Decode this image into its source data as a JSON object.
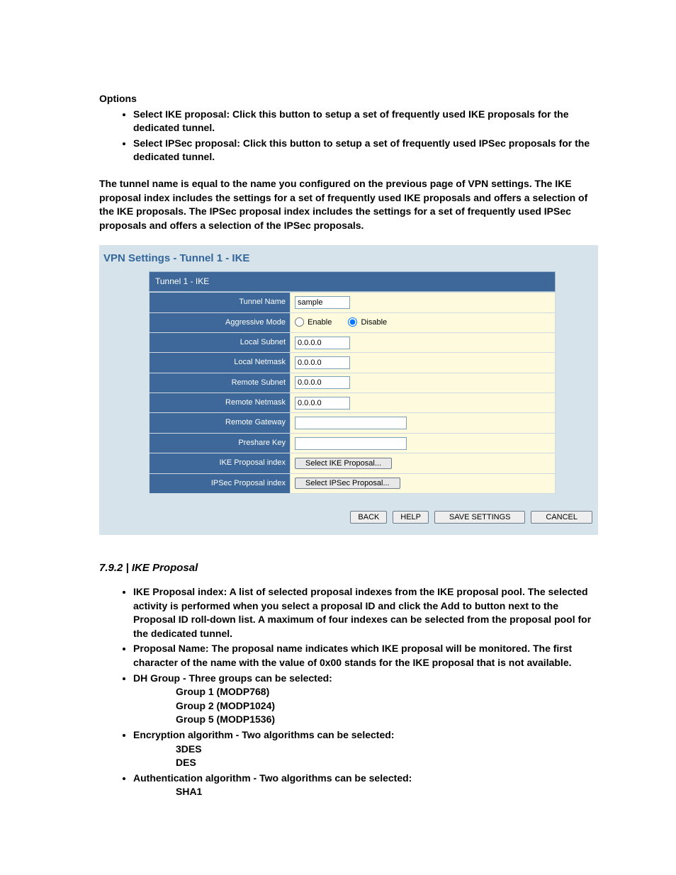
{
  "options_header": "Options",
  "options": [
    "Select IKE proposal: Click this button to setup a set of frequently used IKE proposals for the dedicated tunnel.",
    "Select IPSec proposal: Click this button to setup a set of frequently used IPSec proposals for the dedicated tunnel."
  ],
  "paragraph": "The tunnel name is equal to the name you configured on the previous page of VPN settings. The IKE proposal index includes the settings for a set of frequently used IKE proposals and offers a selection of the IKE proposals. The IPSec proposal index includes the settings for a set of frequently used IPSec proposals and offers a selection of the IPSec proposals.",
  "panel": {
    "title": "VPN Settings - Tunnel 1 - IKE",
    "table_header": "Tunnel 1 - IKE",
    "rows": {
      "tunnel_name": {
        "label": "Tunnel Name",
        "value": "sample"
      },
      "aggressive_mode": {
        "label": "Aggressive Mode",
        "enable": "Enable",
        "disable": "Disable",
        "selected": "disable"
      },
      "local_subnet": {
        "label": "Local Subnet",
        "value": "0.0.0.0"
      },
      "local_netmask": {
        "label": "Local Netmask",
        "value": "0.0.0.0"
      },
      "remote_subnet": {
        "label": "Remote Subnet",
        "value": "0.0.0.0"
      },
      "remote_netmask": {
        "label": "Remote Netmask",
        "value": "0.0.0.0"
      },
      "remote_gateway": {
        "label": "Remote Gateway",
        "value": ""
      },
      "preshare_key": {
        "label": "Preshare Key",
        "value": ""
      },
      "ike_index": {
        "label": "IKE Proposal index",
        "button": "Select IKE Proposal..."
      },
      "ipsec_index": {
        "label": "IPSec Proposal index",
        "button": "Select IPSec Proposal..."
      }
    },
    "buttons": {
      "back": "BACK",
      "help": "HELP",
      "save": "SAVE SETTINGS",
      "cancel": "CANCEL"
    }
  },
  "section2": {
    "heading": "7.9.2 | IKE Proposal",
    "items": [
      "IKE Proposal index: A list of selected proposal indexes from the IKE proposal pool. The selected activity is performed when you select a proposal ID and click the Add to button next to the Proposal ID roll-down list. A maximum of four indexes can be selected from the proposal pool for the dedicated tunnel.",
      "Proposal Name: The proposal name indicates which IKE proposal will be monitored. The first character of the name with the value of 0x00 stands for the IKE proposal that is not available.",
      "DH Group - Three groups can be selected:",
      "Encryption algorithm - Two algorithms can be selected:",
      "Authentication algorithm - Two algorithms can be selected:"
    ],
    "dh_groups": [
      "Group 1 (MODP768)",
      "Group 2 (MODP1024)",
      "Group 5 (MODP1536)"
    ],
    "enc_algs": [
      "3DES",
      "DES"
    ],
    "auth_algs": [
      "SHA1"
    ]
  }
}
